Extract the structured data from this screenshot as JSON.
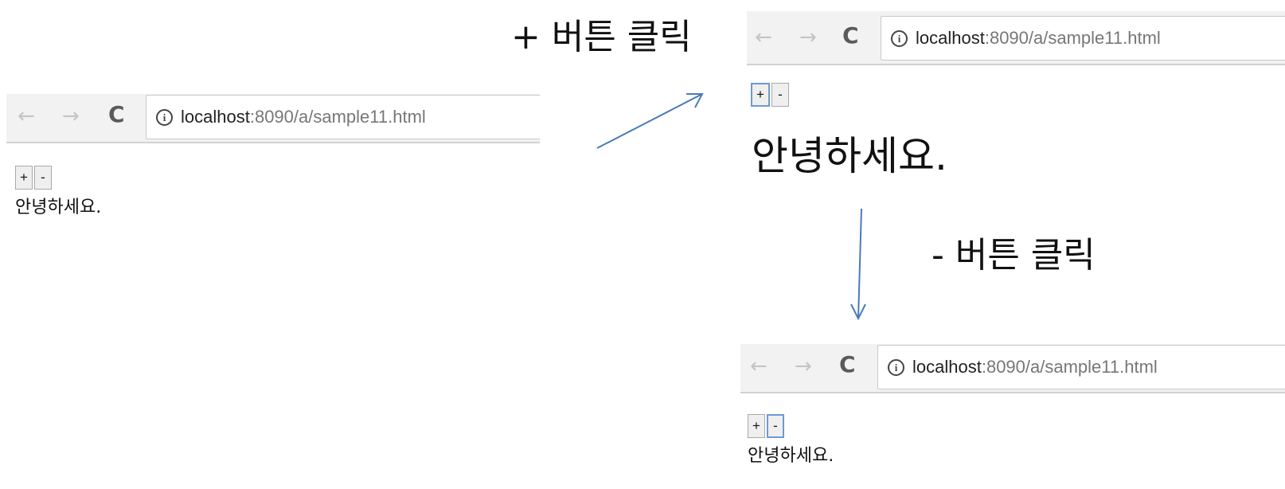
{
  "captions": {
    "plus_click": "+ 버튼 클릭",
    "minus_click": "- 버튼 클릭"
  },
  "browser": {
    "back_icon": "←",
    "forward_icon": "→",
    "reload_icon": "C",
    "info_icon": "i",
    "url_host": "localhost",
    "url_path": ":8090/a/sample11.html"
  },
  "page": {
    "plus_label": "+",
    "minus_label": "-",
    "greeting": "안녕하세요."
  },
  "states": [
    {
      "step": "initial",
      "focused_button": "none",
      "greeting_size": "normal"
    },
    {
      "step": "after-plus-click",
      "focused_button": "plus",
      "greeting_size": "large"
    },
    {
      "step": "after-minus-click",
      "focused_button": "minus",
      "greeting_size": "normal"
    }
  ],
  "colors": {
    "arrow": "#4a7ab8",
    "focus_ring": "#6b9bd1"
  }
}
